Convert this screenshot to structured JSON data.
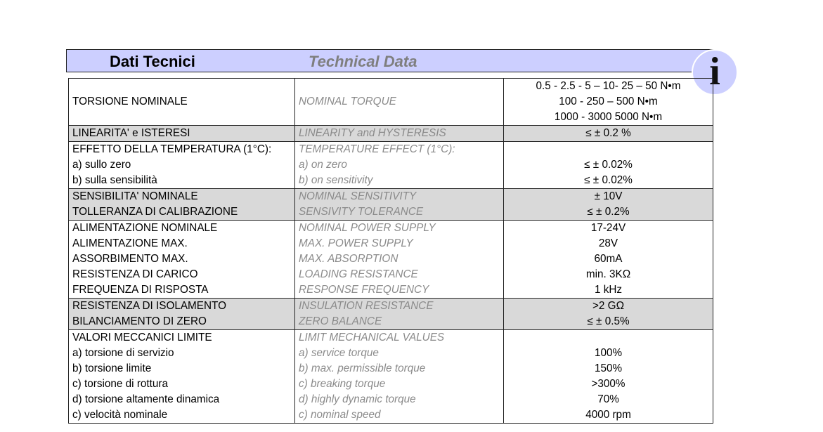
{
  "header": {
    "title_it": "Dati Tecnici",
    "title_en": "Technical Data",
    "info_icon_glyph": "i",
    "colors": {
      "band": "#cccfff",
      "row_shade": "#d9d9d9",
      "english_text": "#8a8a8a"
    }
  },
  "rows": [
    {
      "it": [
        "TORSIONE NOMINALE"
      ],
      "en": [
        "NOMINAL TORQUE"
      ],
      "val": [
        "0.5 - 2.5 - 5 – 10- 25 – 50 N•m",
        "100 - 250 – 500 N•m",
        "1000 - 3000 5000 N•m"
      ],
      "shade": false
    },
    {
      "it": [
        "LINEARITA' e ISTERESI"
      ],
      "en": [
        "LINEARITY and HYSTERESIS"
      ],
      "val": [
        "≤ ± 0.2 %"
      ],
      "shade": true
    },
    {
      "it": [
        "EFFETTO DELLA TEMPERATURA (1°C):",
        "a) sullo zero",
        "b) sulla sensibilità"
      ],
      "en": [
        "TEMPERATURE EFFECT (1°C):",
        "a) on zero",
        "b) on sensitivity"
      ],
      "val": [
        "",
        "≤ ± 0.02%",
        "≤ ± 0.02%"
      ],
      "shade": false
    },
    {
      "it": [
        "SENSIBILITA' NOMINALE",
        "TOLLERANZA DI CALIBRAZIONE"
      ],
      "en": [
        "NOMINAL SENSITIVITY",
        "SENSIVITY TOLERANCE"
      ],
      "val": [
        "± 10V",
        "≤ ± 0.2%"
      ],
      "shade": true
    },
    {
      "it": [
        "ALIMENTAZIONE NOMINALE",
        "ALIMENTAZIONE MAX.",
        "ASSORBIMENTO MAX.",
        "RESISTENZA DI CARICO",
        "FREQUENZA DI RISPOSTA"
      ],
      "en": [
        "NOMINAL POWER SUPPLY",
        "MAX. POWER SUPPLY",
        "MAX. ABSORPTION",
        "LOADING RESISTANCE",
        "RESPONSE FREQUENCY"
      ],
      "val": [
        "17-24V",
        "28V",
        "60mA",
        "min. 3KΩ",
        "1 kHz"
      ],
      "shade": false
    },
    {
      "it": [
        "RESISTENZA DI ISOLAMENTO",
        "BILANCIAMENTO DI ZERO"
      ],
      "en": [
        "INSULATION RESISTANCE",
        "ZERO BALANCE"
      ],
      "val": [
        ">2 GΩ",
        "≤ ± 0.5%"
      ],
      "shade": true
    },
    {
      "it": [
        "VALORI MECCANICI LIMITE",
        "a) torsione di servizio",
        "b) torsione limite",
        "c) torsione di rottura",
        "d) torsione altamente dinamica",
        "c) velocità nominale"
      ],
      "en": [
        "LIMIT MECHANICAL VALUES",
        "a) service torque",
        "b) max. permissible torque",
        "c) breaking torque",
        "d) highly dynamic torque",
        "c) nominal speed"
      ],
      "val": [
        "",
        "100%",
        "150%",
        ">300%",
        "70%",
        "4000 rpm"
      ],
      "shade": false
    }
  ]
}
